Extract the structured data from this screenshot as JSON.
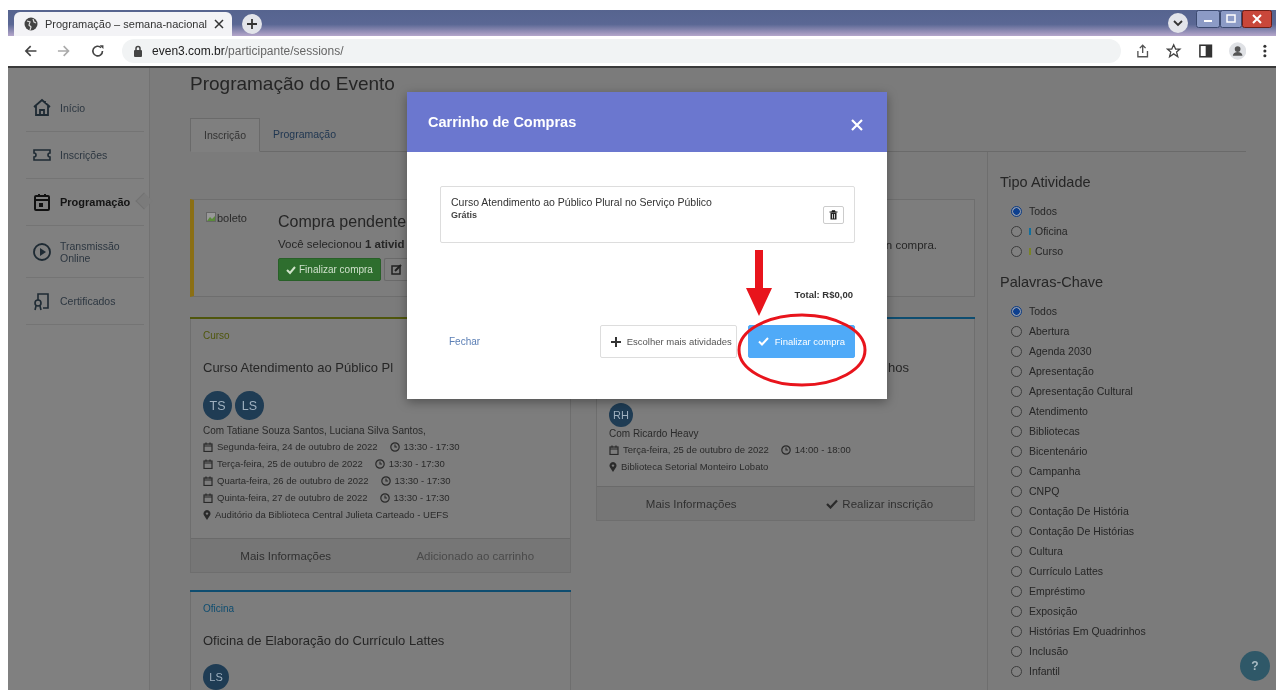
{
  "browser": {
    "tab_title": "Programação – semana-nacional",
    "url_host": "even3.com.br",
    "url_path": "/participante/sessions/"
  },
  "sidebar": {
    "items": [
      {
        "label": "Início",
        "selected": false
      },
      {
        "label": "Inscrições",
        "selected": false
      },
      {
        "label": "Programação",
        "selected": true
      },
      {
        "label": "Transmissão Online",
        "selected": false
      },
      {
        "label": "Certificados",
        "selected": false
      }
    ]
  },
  "page": {
    "title": "Programação do Evento",
    "tabs": [
      {
        "label": "Inscrição",
        "selected": true
      },
      {
        "label": "Programação",
        "selected": false
      }
    ]
  },
  "pending_purchase": {
    "image_alt": "boleto",
    "title": "Compra pendente",
    "message": "Você selecionou **1 ativid**",
    "message_end": "n compra.",
    "button": "Finalizar compra"
  },
  "activities": [
    {
      "category": "Curso",
      "color": "#4f560c",
      "title": "Curso Atendimento ao Público Pl",
      "speakers": [
        "TS",
        "LS"
      ],
      "presenters": "Com Tatiane Souza Santos, Luciana Silva Santos,",
      "sessions": [
        {
          "date": "Segunda-feira, 24 de outubro de 2022",
          "time": "13:30 - 17:30"
        },
        {
          "date": "Terça-feira, 25 de outubro de 2022",
          "time": "13:30 - 17:30"
        },
        {
          "date": "Quarta-feira, 26 de outubro de 2022",
          "time": "13:30 - 17:30"
        },
        {
          "date": "Quinta-feira, 27 de outubro de 2022",
          "time": "13:30 - 17:30"
        }
      ],
      "location": "Auditório da Biblioteca Central Julieta Carteado - UEFS",
      "actions": [
        {
          "label": "Mais Informações",
          "disabled": false,
          "kind": "info"
        },
        {
          "label": "Adicionado ao carrinho",
          "disabled": true,
          "kind": "plain"
        }
      ]
    },
    {
      "color": "#0e4d70",
      "title": "hos",
      "speakers": [
        "RH"
      ],
      "presenters": "Com Ricardo Heavy",
      "sessions": [
        {
          "date": "Terça-feira, 25 de outubro de 2022",
          "time": "14:00 - 18:00"
        }
      ],
      "location": "Biblioteca Setorial Monteiro Lobato",
      "actions": [
        {
          "label": "Mais Informações",
          "disabled": false,
          "kind": "info"
        },
        {
          "label": "Realizar inscrição",
          "disabled": false,
          "kind": "check"
        }
      ]
    },
    {
      "category": "Oficina",
      "color": "#0e4d70",
      "title": "Oficina de Elaboração do Currículo Lattes",
      "speakers": [
        "LS"
      ]
    }
  ],
  "filters": [
    {
      "title": "Tipo Atividade",
      "options": [
        {
          "label": "Todos",
          "selected": true
        },
        {
          "label": "Oficina",
          "selected": false,
          "color": "#0f6f9f"
        },
        {
          "label": "Curso",
          "selected": false,
          "color": "#7b8424"
        }
      ]
    },
    {
      "title": "Palavras-Chave",
      "options": [
        {
          "label": "Todos",
          "selected": true
        },
        {
          "label": "Abertura",
          "selected": false
        },
        {
          "label": "Agenda 2030",
          "selected": false
        },
        {
          "label": "Apresentação",
          "selected": false
        },
        {
          "label": "Apresentação Cultural",
          "selected": false
        },
        {
          "label": "Atendimento",
          "selected": false
        },
        {
          "label": "Bibliotecas",
          "selected": false
        },
        {
          "label": "Bicentenário",
          "selected": false
        },
        {
          "label": "Campanha",
          "selected": false
        },
        {
          "label": "CNPQ",
          "selected": false
        },
        {
          "label": "Contação De História",
          "selected": false
        },
        {
          "label": "Contação De Histórias",
          "selected": false
        },
        {
          "label": "Cultura",
          "selected": false
        },
        {
          "label": "Currículo Lattes",
          "selected": false
        },
        {
          "label": "Empréstimo",
          "selected": false
        },
        {
          "label": "Exposição",
          "selected": false
        },
        {
          "label": "Histórias Em Quadrinhos",
          "selected": false
        },
        {
          "label": "Inclusão",
          "selected": false
        },
        {
          "label": "Infantil",
          "selected": false
        }
      ]
    }
  ],
  "help_button": "?",
  "modal": {
    "title": "Carrinho de Compras",
    "items": [
      {
        "title": "Curso Atendimento ao Público Plural no Serviço Público",
        "price": "Grátis"
      }
    ],
    "total": "Total: R$0,00",
    "close_link": "Fechar",
    "buttons": [
      {
        "label": "Escolher mais atividades",
        "kind": "secondary"
      },
      {
        "label": "Finalizar compra",
        "kind": "primary"
      }
    ]
  }
}
